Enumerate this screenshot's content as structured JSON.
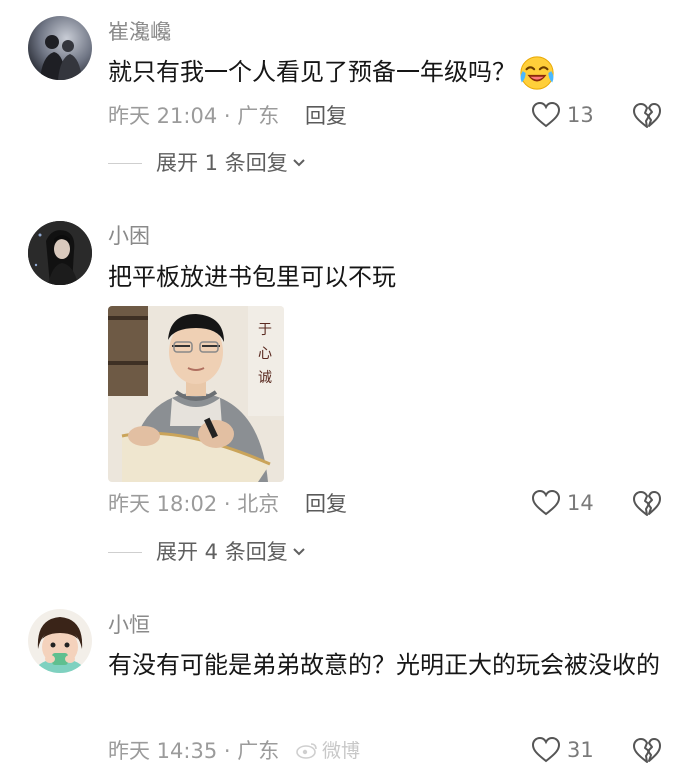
{
  "comments": [
    {
      "username": "崔瀺巉",
      "text": "就只有我一个人看见了预备一年级吗？",
      "meta": "昨天 21:04 · 广东",
      "reply_label": "回复",
      "likes": "13",
      "expand_label": "展开 1 条回复"
    },
    {
      "username": "小困",
      "text": "把平板放进书包里可以不玩",
      "meta": "昨天 18:02 · 北京",
      "reply_label": "回复",
      "likes": "14",
      "expand_label": "展开 4 条回复"
    },
    {
      "username": "小恒",
      "text": "有没有可能是弟弟故意的？光明正大的玩会被没收的",
      "meta": "昨天 14:35 · 广东",
      "reply_label": "回复",
      "likes": "31"
    }
  ],
  "watermark": "微博",
  "icons": {
    "like": "heart-outline-icon",
    "dislike": "broken-heart-icon",
    "expand": "chevron-down-icon",
    "emoji": "laughing-crying-emoji-icon"
  },
  "colors": {
    "username": "#8a8a8a",
    "meta": "#9b9b9b",
    "text": "#161616"
  }
}
